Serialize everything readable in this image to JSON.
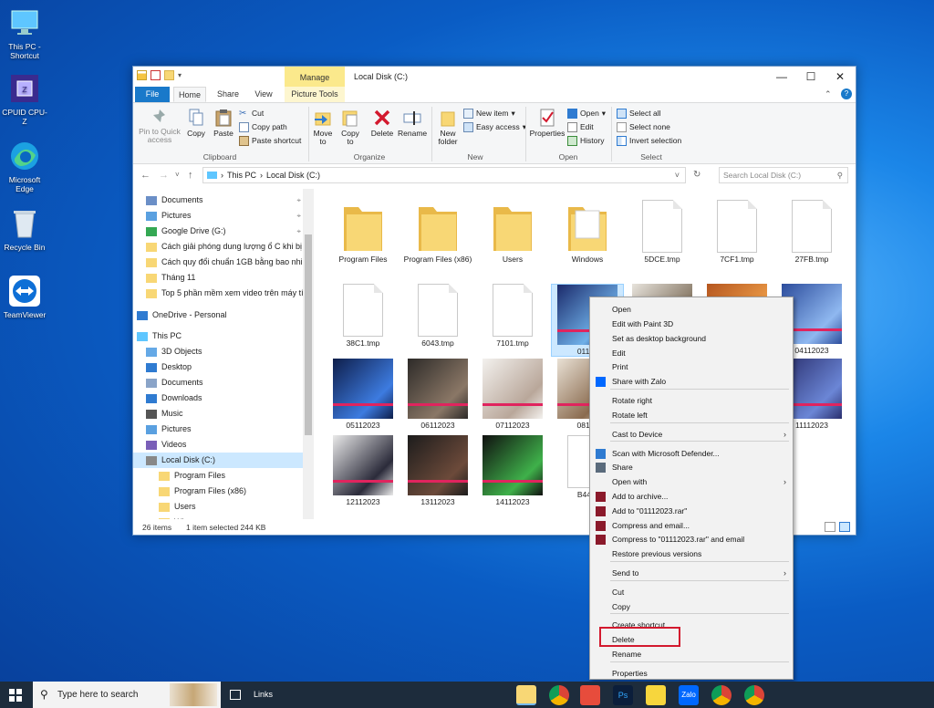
{
  "desktop": {
    "icons": [
      {
        "label": "This PC - Shortcut"
      },
      {
        "label": "CPUID CPU-Z"
      },
      {
        "label": "Microsoft Edge"
      },
      {
        "label": "Recycle Bin"
      },
      {
        "label": "TeamViewer"
      }
    ]
  },
  "window": {
    "title": "Local Disk (C:)",
    "context_tab": "Manage",
    "tabs": {
      "file": "File",
      "home": "Home",
      "share": "Share",
      "view": "View",
      "picture_tools": "Picture Tools"
    },
    "ribbon": {
      "clipboard": {
        "pin": "Pin to Quick access",
        "copy": "Copy",
        "paste": "Paste",
        "cut": "Cut",
        "copy_path": "Copy path",
        "paste_shortcut": "Paste shortcut",
        "group": "Clipboard"
      },
      "organize": {
        "move_to": "Move to",
        "copy_to": "Copy to",
        "delete": "Delete",
        "rename": "Rename",
        "group": "Organize"
      },
      "new": {
        "new_folder": "New folder",
        "new_item": "New item",
        "easy_access": "Easy access",
        "group": "New"
      },
      "open": {
        "properties": "Properties",
        "open": "Open",
        "edit": "Edit",
        "history": "History",
        "group": "Open"
      },
      "select": {
        "select_all": "Select all",
        "select_none": "Select none",
        "invert": "Invert selection",
        "group": "Select"
      }
    },
    "address": {
      "crumbs": [
        "This PC",
        "Local Disk (C:)"
      ],
      "search_placeholder": "Search Local Disk (C:)"
    },
    "nav": [
      {
        "label": "Documents",
        "pin": true
      },
      {
        "label": "Pictures",
        "pin": true
      },
      {
        "label": "Google Drive (G:)",
        "pin": true
      },
      {
        "label": "Cách giải phóng dung lượng ổ C khi bị"
      },
      {
        "label": "Cách quy đổi chuẩn 1GB bằng bao nhiê"
      },
      {
        "label": "Tháng 11"
      },
      {
        "label": "Top 5 phần mềm xem video trên máy tí"
      },
      {
        "label": "OneDrive - Personal"
      },
      {
        "label": "This PC"
      },
      {
        "label": "3D Objects"
      },
      {
        "label": "Desktop"
      },
      {
        "label": "Documents"
      },
      {
        "label": "Downloads"
      },
      {
        "label": "Music"
      },
      {
        "label": "Pictures"
      },
      {
        "label": "Videos"
      },
      {
        "label": "Local Disk (C:)"
      },
      {
        "label": "Program Files"
      },
      {
        "label": "Program Files (x86)"
      },
      {
        "label": "Users"
      },
      {
        "label": "Wi..."
      }
    ],
    "items": [
      {
        "name": "Program Files",
        "kind": "folder"
      },
      {
        "name": "Program Files (x86)",
        "kind": "folder"
      },
      {
        "name": "Users",
        "kind": "folder"
      },
      {
        "name": "Windows",
        "kind": "folder"
      },
      {
        "name": "5DCE.tmp",
        "kind": "doc"
      },
      {
        "name": "7CF1.tmp",
        "kind": "doc"
      },
      {
        "name": "27FB.tmp",
        "kind": "doc"
      },
      {
        "name": "38C1.tmp",
        "kind": "doc"
      },
      {
        "name": "6043.tmp",
        "kind": "doc"
      },
      {
        "name": "7101.tmp",
        "kind": "doc"
      },
      {
        "name": "01112",
        "kind": "photo"
      },
      {
        "name": "",
        "kind": "photo"
      },
      {
        "name": "",
        "kind": "photo"
      },
      {
        "name": "04112023",
        "kind": "photo"
      },
      {
        "name": "05112023",
        "kind": "photo"
      },
      {
        "name": "06112023",
        "kind": "photo"
      },
      {
        "name": "07112023",
        "kind": "photo"
      },
      {
        "name": "08112",
        "kind": "photo"
      },
      {
        "name": "",
        "kind": "photo"
      },
      {
        "name": "",
        "kind": "photo"
      },
      {
        "name": "11112023",
        "kind": "photo"
      },
      {
        "name": "12112023",
        "kind": "photo"
      },
      {
        "name": "13112023",
        "kind": "photo"
      },
      {
        "name": "14112023",
        "kind": "photo"
      },
      {
        "name": "B441.",
        "kind": "doc"
      }
    ],
    "status": {
      "count": "26 items",
      "selected": "1 item selected  244 KB"
    }
  },
  "context_menu": {
    "items": [
      {
        "label": "Open"
      },
      {
        "label": "Edit with Paint 3D"
      },
      {
        "label": "Set as desktop background"
      },
      {
        "label": "Edit"
      },
      {
        "label": "Print"
      },
      {
        "label": "Share with Zalo"
      },
      {
        "label": "Rotate right"
      },
      {
        "label": "Rotate left"
      },
      {
        "label": "Cast to Device"
      },
      {
        "label": "Scan with Microsoft Defender..."
      },
      {
        "label": "Share"
      },
      {
        "label": "Open with"
      },
      {
        "label": "Add to archive..."
      },
      {
        "label": "Add to \"01112023.rar\""
      },
      {
        "label": "Compress and email..."
      },
      {
        "label": "Compress to \"01112023.rar\" and email"
      },
      {
        "label": "Restore previous versions"
      },
      {
        "label": "Send to"
      },
      {
        "label": "Cut"
      },
      {
        "label": "Copy"
      },
      {
        "label": "Create shortcut"
      },
      {
        "label": "Delete"
      },
      {
        "label": "Rename"
      },
      {
        "label": "Properties"
      }
    ]
  },
  "taskbar": {
    "search_placeholder": "Type here to search",
    "links": "Links"
  },
  "colors": {
    "accent": "#1979ca",
    "selection": "#cce8ff",
    "highlight_box": "#d3192e",
    "folder": "#f8d775"
  }
}
